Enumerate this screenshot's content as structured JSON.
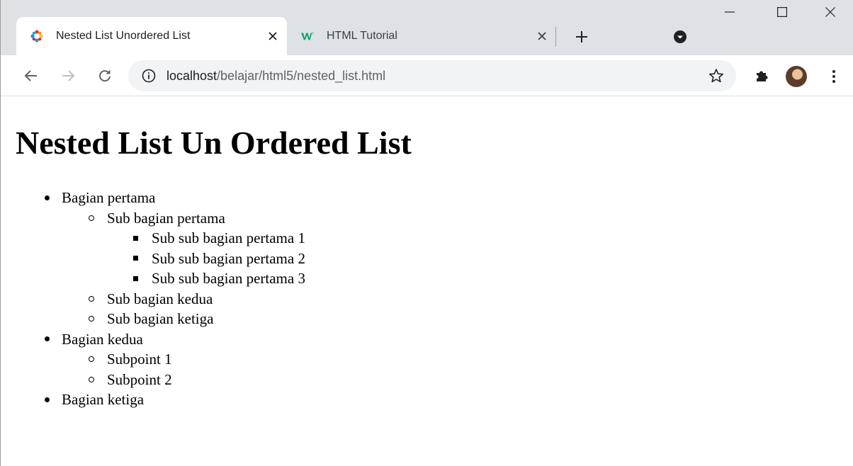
{
  "browser": {
    "tabs": [
      {
        "title": "Nested List Unordered List",
        "active": true,
        "favicon": "colorful-puzzle-icon"
      },
      {
        "title": "HTML Tutorial",
        "active": false,
        "favicon": "w3schools-icon"
      }
    ],
    "address": {
      "host": "localhost",
      "path": "/belajar/html5/nested_list.html"
    }
  },
  "page": {
    "heading": "Nested List Un Ordered List",
    "list": [
      {
        "label": "Bagian pertama",
        "level": 1,
        "marker": "disc"
      },
      {
        "label": "Sub bagian pertama",
        "level": 2,
        "marker": "circle"
      },
      {
        "label": "Sub sub bagian pertama 1",
        "level": 3,
        "marker": "square"
      },
      {
        "label": "Sub sub bagian pertama 2",
        "level": 3,
        "marker": "square"
      },
      {
        "label": "Sub sub bagian pertama 3",
        "level": 3,
        "marker": "square"
      },
      {
        "label": "Sub bagian kedua",
        "level": 2,
        "marker": "circle"
      },
      {
        "label": "Sub bagian ketiga",
        "level": 2,
        "marker": "circle"
      },
      {
        "label": "Bagian kedua",
        "level": 1,
        "marker": "disc"
      },
      {
        "label": "Subpoint 1",
        "level": 2,
        "marker": "circle"
      },
      {
        "label": "Subpoint 2",
        "level": 2,
        "marker": "circle"
      },
      {
        "label": "Bagian ketiga",
        "level": 1,
        "marker": "disc"
      }
    ]
  },
  "colors": {
    "tabstrip_bg": "#dee1e6",
    "omnibox_bg": "#f1f3f4",
    "icon": "#5f6368",
    "text": "#202124"
  }
}
